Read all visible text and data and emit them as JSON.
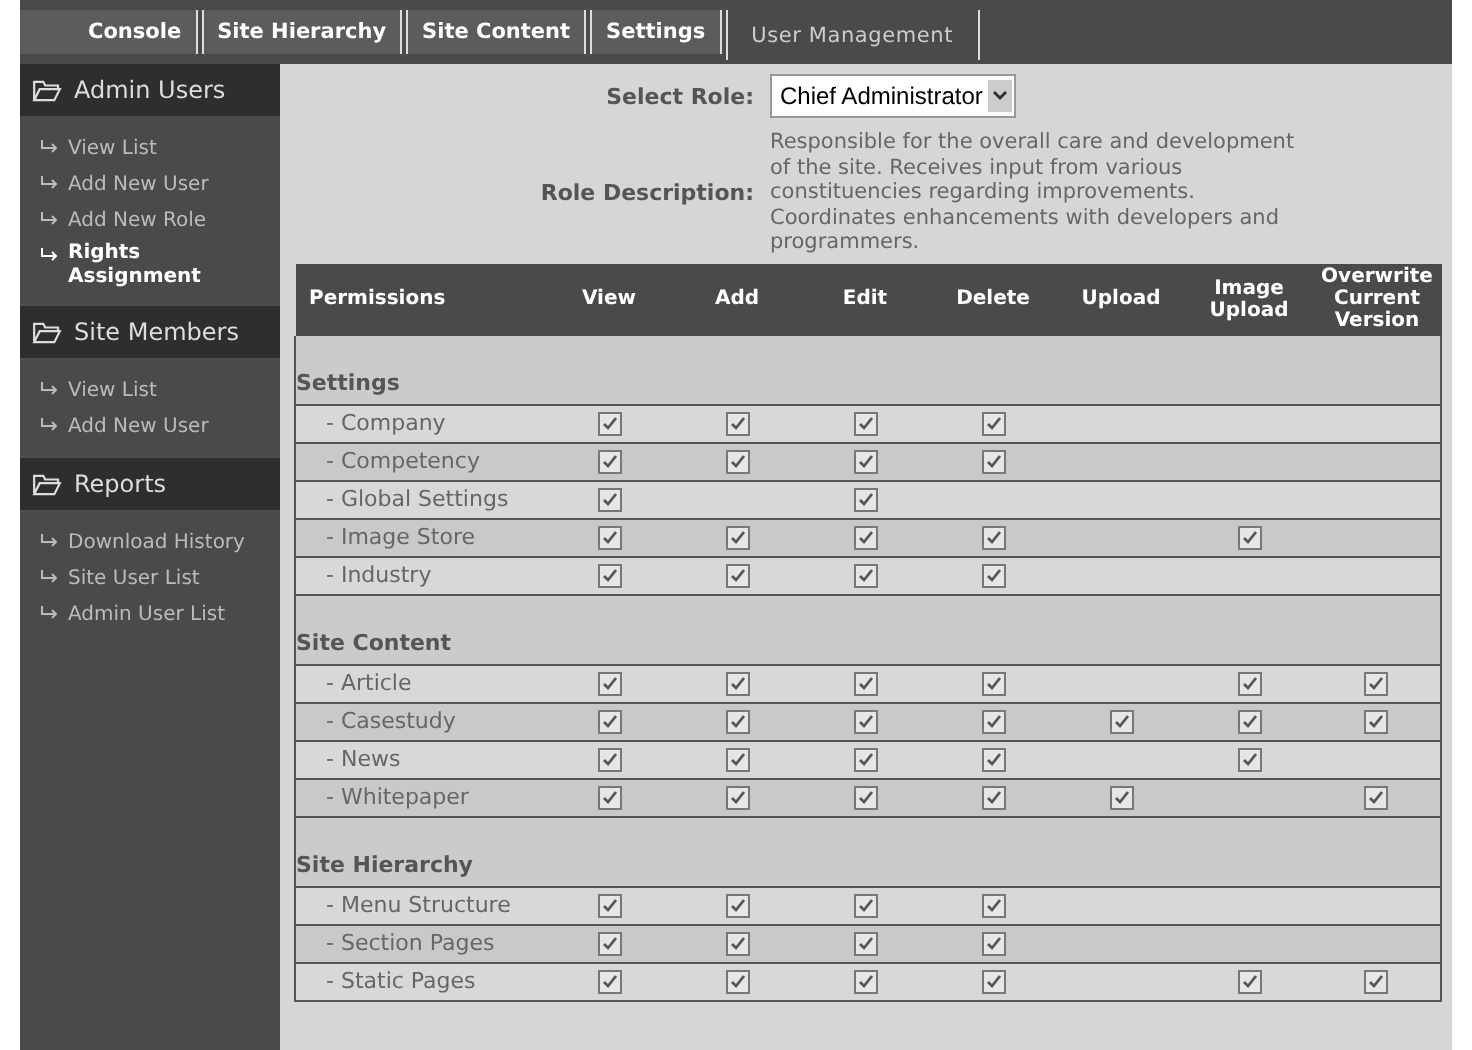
{
  "tabs": [
    {
      "label": "Console",
      "selected": false
    },
    {
      "label": "Site Hierarchy",
      "selected": false
    },
    {
      "label": "Site Content",
      "selected": false
    },
    {
      "label": "Settings",
      "selected": false
    },
    {
      "label": "User Management",
      "selected": true
    }
  ],
  "sidebar": {
    "sections": [
      {
        "title": "Admin Users",
        "items": [
          {
            "label": "View List",
            "selected": false
          },
          {
            "label": "Add New User",
            "selected": false
          },
          {
            "label": "Add New Role",
            "selected": false
          },
          {
            "label": "Rights Assignment",
            "selected": true
          }
        ]
      },
      {
        "title": "Site Members",
        "items": [
          {
            "label": "View List",
            "selected": false
          },
          {
            "label": "Add New User",
            "selected": false
          }
        ]
      },
      {
        "title": "Reports",
        "items": [
          {
            "label": "Download History",
            "selected": false
          },
          {
            "label": "Site User List",
            "selected": false
          },
          {
            "label": "Admin User List",
            "selected": false
          }
        ]
      }
    ]
  },
  "role": {
    "label": "Select Role:",
    "value": "Chief Administrator",
    "description_label": "Role Description:",
    "description": "Responsible for the overall care and development of the site. Receives input from various constituencies regarding improvements. Coordinates enhancements with developers and programmers."
  },
  "table": {
    "columns": [
      "Permissions",
      "View",
      "Add",
      "Edit",
      "Delete",
      "Upload",
      "Image Upload",
      "Overwrite Current Version"
    ],
    "groups": [
      {
        "title": "Settings",
        "rows": [
          {
            "name": "- Company",
            "granted": [
              true,
              true,
              true,
              true,
              false,
              false,
              false
            ]
          },
          {
            "name": "- Competency",
            "granted": [
              true,
              true,
              true,
              true,
              false,
              false,
              false
            ]
          },
          {
            "name": "- Global Settings",
            "granted": [
              true,
              false,
              true,
              false,
              false,
              false,
              false
            ]
          },
          {
            "name": "- Image Store",
            "granted": [
              true,
              true,
              true,
              true,
              false,
              true,
              false
            ]
          },
          {
            "name": "- Industry",
            "granted": [
              true,
              true,
              true,
              true,
              false,
              false,
              false
            ]
          }
        ]
      },
      {
        "title": "Site Content",
        "rows": [
          {
            "name": "- Article",
            "granted": [
              true,
              true,
              true,
              true,
              false,
              true,
              true
            ]
          },
          {
            "name": "- Casestudy",
            "granted": [
              true,
              true,
              true,
              true,
              true,
              true,
              true
            ]
          },
          {
            "name": "- News",
            "granted": [
              true,
              true,
              true,
              true,
              false,
              true,
              false
            ]
          },
          {
            "name": "- Whitepaper",
            "granted": [
              true,
              true,
              true,
              true,
              true,
              false,
              true
            ]
          }
        ]
      },
      {
        "title": "Site Hierarchy",
        "rows": [
          {
            "name": "- Menu Structure",
            "granted": [
              true,
              true,
              true,
              true,
              false,
              false,
              false
            ]
          },
          {
            "name": "- Section Pages",
            "granted": [
              true,
              true,
              true,
              true,
              false,
              false,
              false
            ]
          },
          {
            "name": "- Static Pages",
            "granted": [
              true,
              true,
              true,
              true,
              false,
              true,
              true
            ]
          }
        ]
      }
    ]
  }
}
